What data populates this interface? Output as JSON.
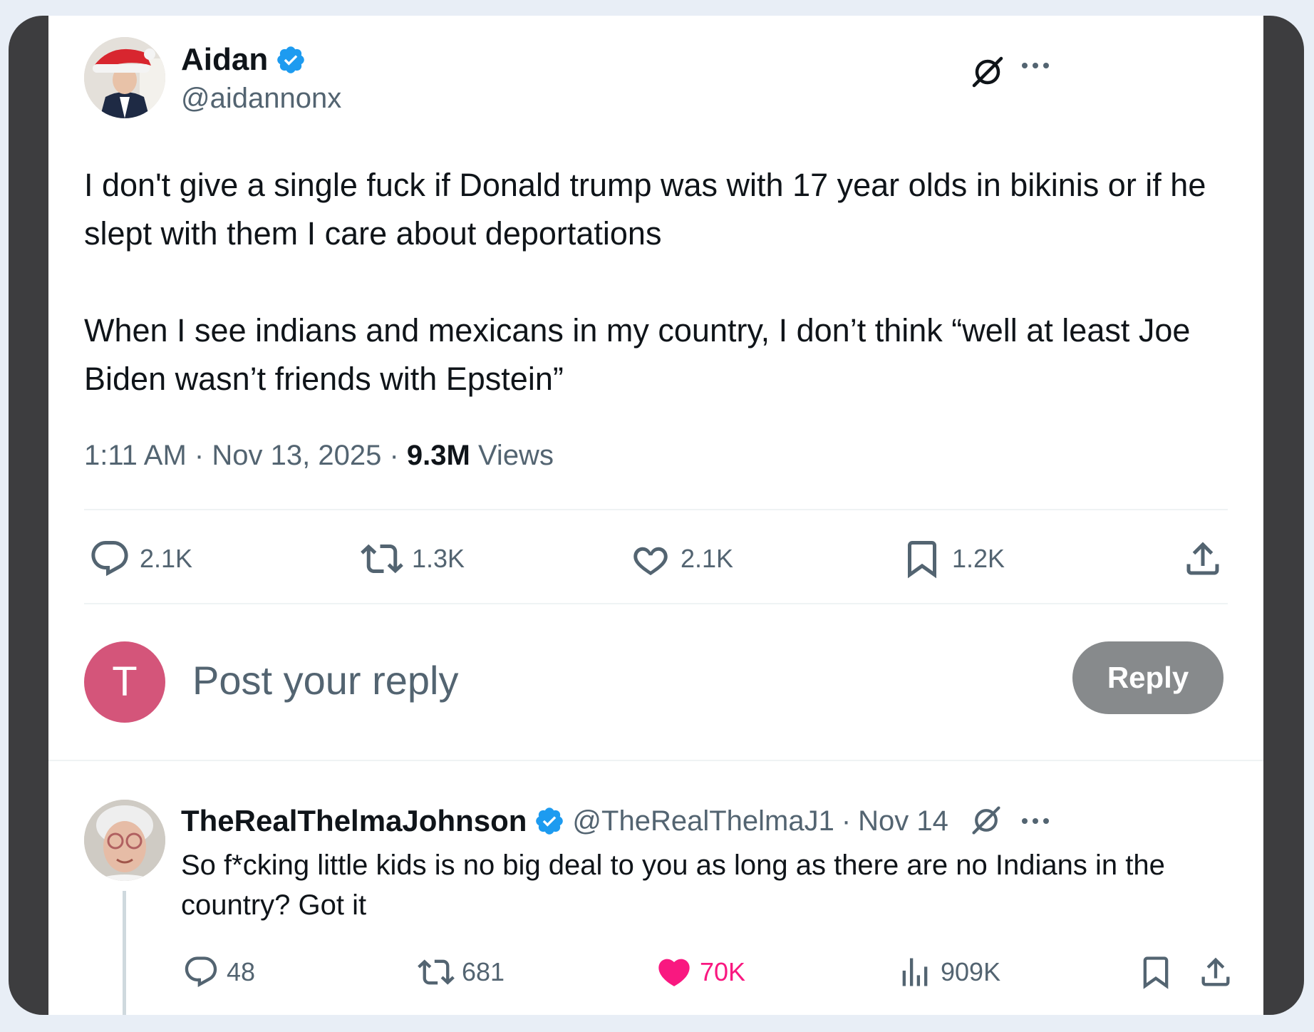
{
  "main_post": {
    "display_name": "Aidan",
    "handle": "@aidannonx",
    "text_paragraphs": [
      "I don't give a single fuck if Donald trump was with 17 year olds in bikinis or if he slept with them I care about deportations",
      "When I see indians and mexicans in my country, I don’t think “well at least Joe Biden wasn’t friends with Epstein”"
    ],
    "time": "1:11 AM",
    "date": "Nov 13, 2025",
    "separator": "·",
    "views_count": "9.3M",
    "views_label": "Views",
    "stats": {
      "replies": "2.1K",
      "reposts": "1.3K",
      "likes": "2.1K",
      "bookmarks": "1.2K"
    }
  },
  "reply_composer": {
    "avatar_letter": "T",
    "placeholder": "Post your reply",
    "button_label": "Reply",
    "avatar_color": "#d4557a"
  },
  "reply_post": {
    "display_name": "TheRealThelmaJohnson",
    "handle": "@TheRealThelmaJ1",
    "separator": "·",
    "date": "Nov 14",
    "text": "So f*cking little kids is no big deal to you as long as there are no Indians in the country?  Got it",
    "stats": {
      "replies": "48",
      "reposts": "681",
      "likes": "70K",
      "views": "909K"
    },
    "liked": true
  },
  "colors": {
    "verified_blue": "#1d9bf0",
    "like_pink": "#f91880",
    "secondary_text": "#536471",
    "primary_text": "#0f1419"
  },
  "icons": [
    "verified-badge-icon",
    "grok-icon",
    "more-icon",
    "reply-icon",
    "repost-icon",
    "like-icon",
    "bookmark-icon",
    "share-icon",
    "views-icon"
  ]
}
